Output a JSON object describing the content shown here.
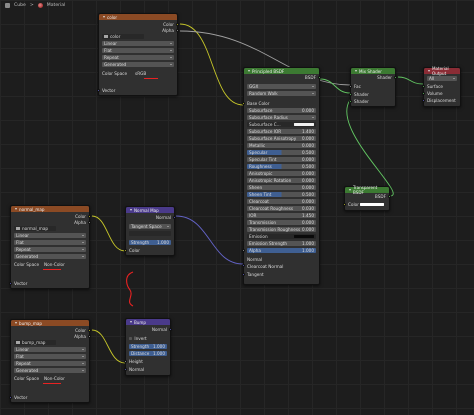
{
  "breadcrumb": {
    "object": "Cube",
    "separator": ">",
    "material": "Material"
  },
  "colors": {
    "texture_header": "#8b4a24",
    "shader_header": "#3c7a32",
    "vector_header": "#4a3a8a",
    "output_header": "#8a2c35",
    "annotation": "#e82222"
  },
  "color_tex": {
    "title": "color",
    "outputs": [
      "Color",
      "Alpha"
    ],
    "image_name": "color",
    "interpolation": "Linear",
    "projection": "Flat",
    "extension": "Repeat",
    "source": "Generated",
    "color_space_label": "Color Space",
    "color_space": "sRGB",
    "input": "Vector"
  },
  "normal_tex": {
    "title": "normal_map",
    "outputs": [
      "Color",
      "Alpha"
    ],
    "image_name": "normal_map",
    "interpolation": "Linear",
    "projection": "Flat",
    "extension": "Repeat",
    "source": "Generated",
    "color_space_label": "Color Space",
    "color_space": "Non-Color",
    "input": "Vector"
  },
  "bump_tex": {
    "title": "bump_map",
    "outputs": [
      "Color",
      "Alpha"
    ],
    "image_name": "bump_map",
    "interpolation": "Linear",
    "projection": "Flat",
    "extension": "Repeat",
    "source": "Generated",
    "color_space_label": "Color Space",
    "color_space": "Non-Color",
    "input": "Vector"
  },
  "normal_map": {
    "title": "Normal Map",
    "output": "Normal",
    "space": "Tangent Space",
    "strength_label": "Strength",
    "strength": "1.000",
    "input": "Color"
  },
  "bump": {
    "title": "Bump",
    "output": "Normal",
    "invert": "Invert",
    "strength_label": "Strength",
    "strength": "1.000",
    "distance_label": "Distance",
    "distance": "1.000",
    "inputs": [
      "Height",
      "Normal"
    ]
  },
  "principled": {
    "title": "Principled BSDF",
    "output": "BSDF",
    "distribution": "GGX",
    "subsurface_method": "Random Walk",
    "base_color": "Base Color",
    "params": [
      {
        "label": "Subsurface",
        "value": "0.000"
      },
      {
        "label": "Subsurface Radius",
        "value": ""
      },
      {
        "label": "Subsurface C...",
        "value": ""
      },
      {
        "label": "Subsurface IOR",
        "value": "1.400"
      },
      {
        "label": "Subsurface Anisotropy",
        "value": "0.000"
      },
      {
        "label": "Metallic",
        "value": "0.000"
      },
      {
        "label": "Specular",
        "value": "0.500"
      },
      {
        "label": "Specular Tint",
        "value": "0.000"
      },
      {
        "label": "Roughness",
        "value": "0.500"
      },
      {
        "label": "Anisotropic",
        "value": "0.000"
      },
      {
        "label": "Anisotropic Rotation",
        "value": "0.000"
      },
      {
        "label": "Sheen",
        "value": "0.000"
      },
      {
        "label": "Sheen Tint",
        "value": "0.500"
      },
      {
        "label": "Clearcoat",
        "value": "0.000"
      },
      {
        "label": "Clearcoat Roughness",
        "value": "0.030"
      },
      {
        "label": "IOR",
        "value": "1.450"
      },
      {
        "label": "Transmission",
        "value": "0.000"
      },
      {
        "label": "Transmission Roughness",
        "value": "0.000"
      },
      {
        "label": "Emission",
        "value": ""
      },
      {
        "label": "Emission Strength",
        "value": "1.000"
      },
      {
        "label": "Alpha",
        "value": "1.000"
      }
    ],
    "normal": "Normal",
    "clearcoat_normal": "Clearcoat Normal",
    "tangent": "Tangent"
  },
  "mix_shader": {
    "title": "Mix Shader",
    "output": "Shader",
    "inputs": [
      "Fac",
      "Shader",
      "Shader"
    ]
  },
  "transparent": {
    "title": "Transparent BSDF",
    "output": "BSDF",
    "input": "Color"
  },
  "material_output": {
    "title": "Material Output",
    "target": "All",
    "inputs": [
      "Surface",
      "Volume",
      "Displacement"
    ]
  }
}
